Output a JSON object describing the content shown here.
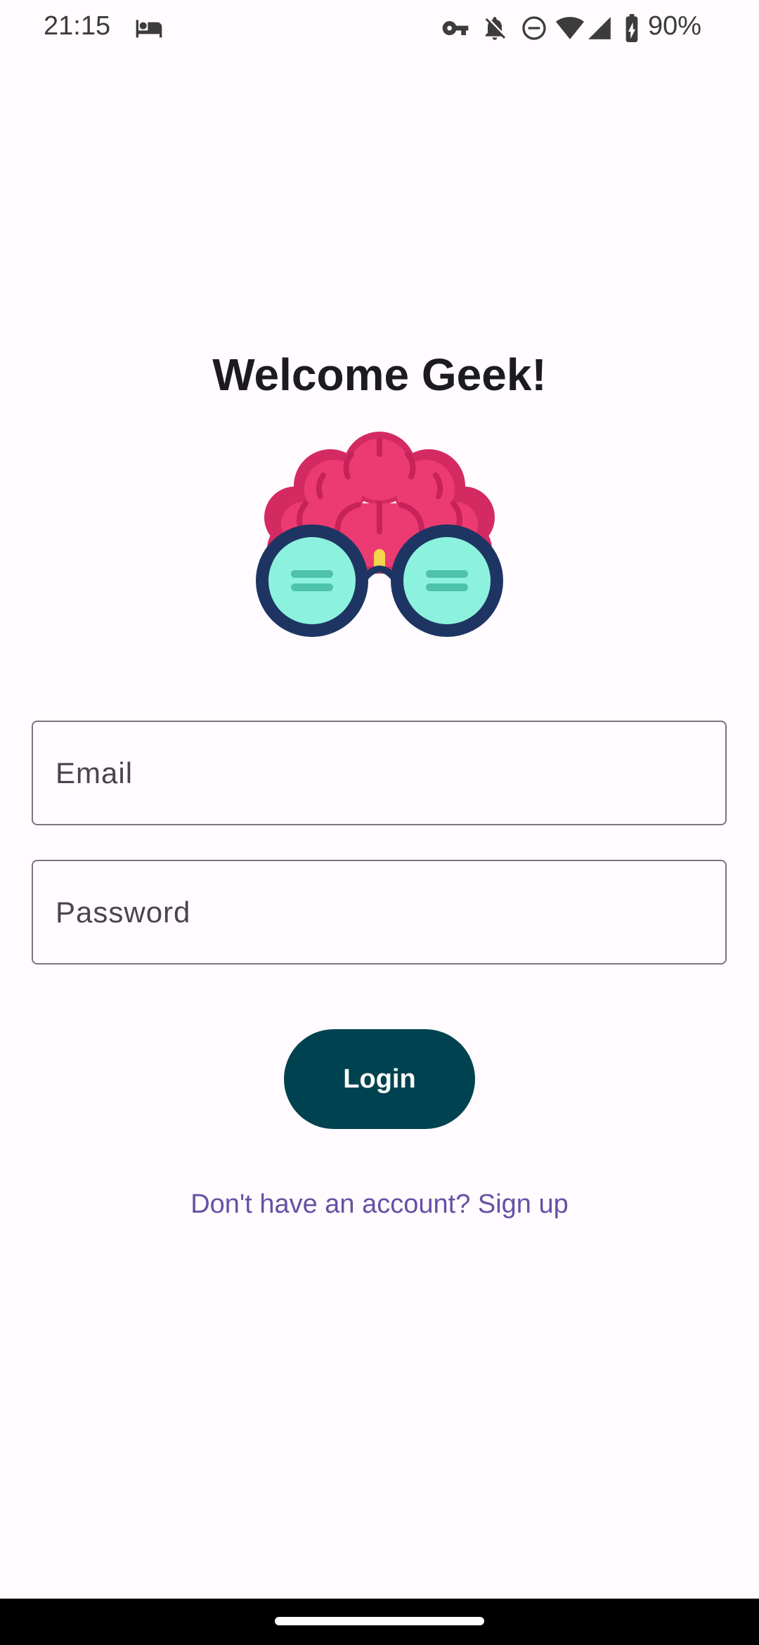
{
  "status_bar": {
    "time": "21:15",
    "battery": "90%",
    "icons": [
      "bed-icon",
      "vpn-key-icon",
      "notifications-off-icon",
      "do-not-disturb-icon",
      "wifi-icon",
      "signal-icon",
      "battery-charging-icon"
    ]
  },
  "login": {
    "title": "Welcome Geek!",
    "logo_icon": "geek-brain-glasses-icon",
    "email_label": "Email",
    "password_label": "Password",
    "login_button": "Login",
    "signup_link": "Don't have an account? Sign up"
  },
  "colors": {
    "button_bg": "#00424f",
    "link": "#6750a4",
    "brain": "#ec3b72",
    "glasses_frame": "#1e3563",
    "lens": "#8df2dd"
  }
}
